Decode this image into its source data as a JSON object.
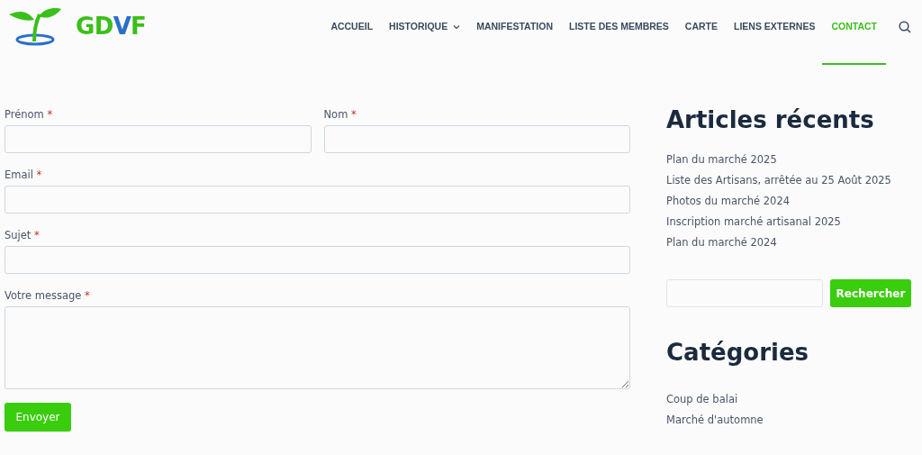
{
  "logo": {
    "letters": [
      {
        "text": "GD",
        "accent": false
      },
      {
        "text": "V",
        "accent": true
      },
      {
        "text": "F",
        "accent": false
      }
    ]
  },
  "nav": [
    {
      "label": "ACCUEIL",
      "selected": false,
      "has_submenu": false
    },
    {
      "label": "HISTORIQUE",
      "selected": false,
      "has_submenu": true
    },
    {
      "label": "MANIFESTATION",
      "selected": false,
      "has_submenu": false
    },
    {
      "label": "LISTE DES MEMBRES",
      "selected": false,
      "has_submenu": false
    },
    {
      "label": "CARTE",
      "selected": false,
      "has_submenu": false
    },
    {
      "label": "LIENS EXTERNES",
      "selected": false,
      "has_submenu": false
    },
    {
      "label": "CONTACT",
      "selected": true,
      "has_submenu": false
    }
  ],
  "form": {
    "rows": [
      [
        {
          "label": "Prénom",
          "required_mark": "*",
          "kind": "text"
        },
        {
          "label": "Nom",
          "required_mark": "*",
          "kind": "text"
        }
      ],
      [
        {
          "label": "Email",
          "required_mark": "*",
          "kind": "text"
        }
      ],
      [
        {
          "label": "Sujet",
          "required_mark": "*",
          "kind": "text"
        }
      ],
      [
        {
          "label": "Votre message",
          "required_mark": "*",
          "kind": "textarea"
        }
      ]
    ],
    "submit": "Envoyer"
  },
  "sidebar": {
    "recent_title": "Articles récents",
    "recent": [
      "Plan du marché 2025",
      "Liste des Artisans, arrêtée au 25 Août 2025",
      "Photos du marché 2024",
      "Inscription marché artisanal 2025",
      "Plan du marché 2024"
    ],
    "search_button": "Rechercher",
    "categories_title": "Catégories",
    "categories": [
      "Coup de balai",
      "Marché d'automne"
    ]
  }
}
